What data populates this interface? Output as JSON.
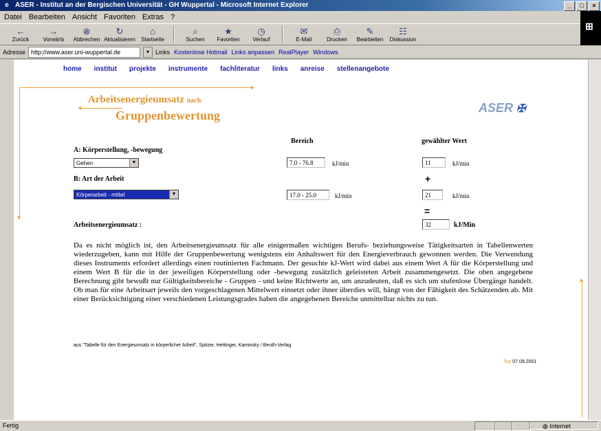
{
  "browser": {
    "title": "ASER - Institut an der Bergischen Universität - GH Wuppertal - Microsoft Internet Explorer",
    "menu": [
      "Datei",
      "Bearbeiten",
      "Ansicht",
      "Favoriten",
      "Extras",
      "?"
    ],
    "toolbar": [
      "Zurück",
      "Vorwärts",
      "Abbrechen",
      "Aktualisieren",
      "Startseite",
      "Suchen",
      "Favoriten",
      "Verlauf",
      "E-Mail",
      "Drucken",
      "Bearbeiten",
      "Diskussion"
    ],
    "address_label": "Adresse",
    "address_value": "http://www.aser.uni-wuppertal.de",
    "links_label": "Links",
    "links": [
      "Kostenlose Hotmail",
      "Links anpassen",
      "RealPlayer",
      "Windows"
    ],
    "status_text": "Fertig",
    "zone_text": "Internet"
  },
  "page": {
    "nav": [
      "home",
      "institut",
      "projekte",
      "instrumente",
      "fachliteratur",
      "links",
      "anreise",
      "stellenangebote"
    ],
    "heading_line1": "Arbeitsenergieumsatz",
    "heading_line1_suffix": "nach",
    "heading_line2": "Gruppenbewertung",
    "logo_text": "ASER",
    "logo_sub": "ASER",
    "col_range": "Bereich",
    "col_value": "gewählter Wert",
    "section_a": "A: Körperstellung, -bewegung",
    "select_a": "Gehen",
    "range_a": "7.0 - 76.8",
    "unit_a": "kJ/min",
    "value_a": "11",
    "unit_a2": "kJ/min",
    "plus": "+",
    "section_b": "B: Art der Arbeit",
    "select_b": "Körperarbeit - mittel",
    "range_b": "17.0 - 25.0",
    "unit_b": "kJ/min",
    "value_b": "21",
    "unit_b2": "kJ/min",
    "equals": "=",
    "total_label": "Arbeitsenergieumsatz :",
    "total_value": "32",
    "total_unit": "kJ/Min",
    "paragraph": "Da es nicht möglich ist, den Arbeitsenergieumsatz für alle einigermaßen wichtigen Berufs- beziehungsweise Tätigkeitsarten in Tabellenwerten wiederzugeben, kann mit Hilfe der Gruppenbewertung wenigstens ein Anhaltswert für den Energieverbrauch gewonnen werden. Die Verwendung dieses Instruments erfordert allerdings einen routinierten Fachmann. Der gesuchte kJ-Wert wird dabei aus einem Wert A für die Körperstellung und einem Wert B für die in der jeweiligen Körperstellung oder -bewegung zusätzlich geleisteten Arbeit zusammengesetzt. Die oben angegebene Berechnung gibt bewußt nur Gültigkeitsbereiche - Gruppen - und keine Richtwerte an, um anzudeuten, daß es sich um stufenlose Übergänge handelt. Ob man für eine Arbeitsart jeweils den vorgeschlagenen Mittelwert einsetzt oder ihner überdies will, hängt von der Fähigkeit des Schätzenden ab. Mit einer Berücksichtigung einer verschiedenen Leistungsgrades haben die angegebenen Bereiche unmittelbar nichts zu tun.",
    "footnote": "aus \"Tabelle für den Energieumsatz in körperlicher Arbeit\", Spitzer, Hettinger, Kaminsky / Beuth-Verlag",
    "date_link": "Top",
    "date_text": "07.09.2001"
  }
}
